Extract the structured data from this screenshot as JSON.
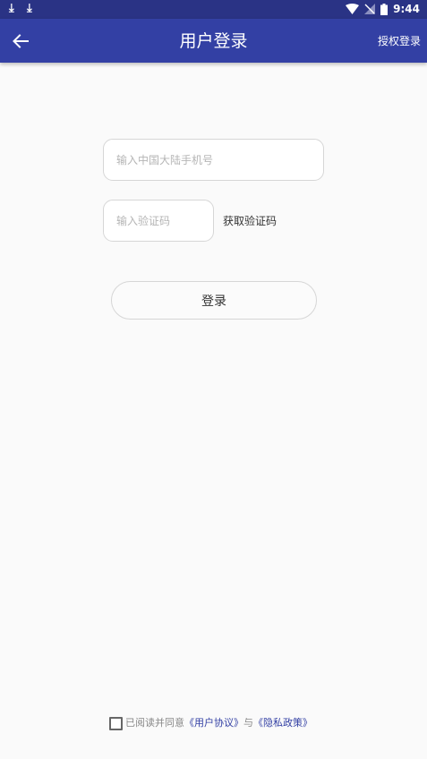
{
  "status_bar": {
    "download_icons": [
      "download-icon",
      "download-icon"
    ],
    "time": "9:44",
    "icons": [
      "wifi-icon",
      "no-signal-icon",
      "battery-icon"
    ]
  },
  "app_bar": {
    "back_icon": "arrow-left-icon",
    "title": "用户登录",
    "action_label": "授权登录"
  },
  "form": {
    "phone_placeholder": "输入中国大陆手机号",
    "code_placeholder": "输入验证码",
    "get_code_label": "获取验证码",
    "login_label": "登录"
  },
  "agreement": {
    "prefix": "已阅读并同意",
    "user_agreement": "《用户协议》",
    "conjunction": "与",
    "privacy_policy": "《隐私政策》",
    "checked": false
  },
  "colors": {
    "status_bar": "#2a3385",
    "app_bar": "#3340a4",
    "link": "#3340a4",
    "background": "#fafafa"
  }
}
